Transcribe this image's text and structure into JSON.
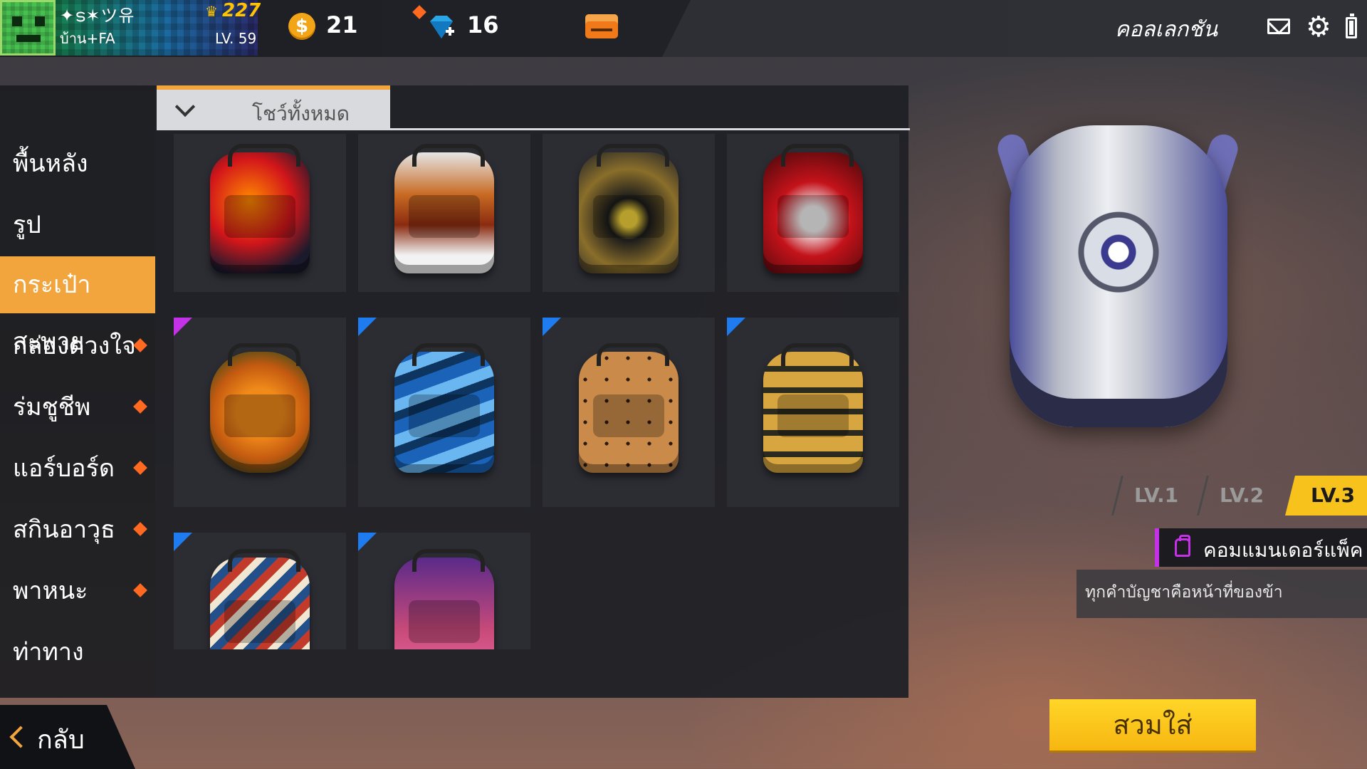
{
  "player": {
    "name": "✦ട✶ツ유",
    "subtitle": "บ้าน+FA",
    "score": "227",
    "level": "LV. 59"
  },
  "currency": {
    "coins_symbol": "$",
    "coins": "21",
    "diamonds": "16"
  },
  "header": {
    "title": "คอลเลกชัน"
  },
  "icons": {
    "gear": "⚙",
    "crown": "♛"
  },
  "sidebar": {
    "items": [
      {
        "label": "พื้นหลัง"
      },
      {
        "label": "รูป"
      },
      {
        "label": "กระเป๋าสะพาย"
      },
      {
        "label": "กล่องดวงใจ"
      },
      {
        "label": "ร่มชูชีพ"
      },
      {
        "label": "แอร์บอร์ด"
      },
      {
        "label": "สกินอาวุธ"
      },
      {
        "label": "พาหนะ"
      },
      {
        "label": "ท่าทาง"
      }
    ],
    "active_index": 2
  },
  "filter": {
    "label": "โชว์ทั้งหมด"
  },
  "item_grid": {
    "items": [
      {
        "name": "flame-backpack",
        "rarity": "none"
      },
      {
        "name": "tiger-backpack",
        "rarity": "none"
      },
      {
        "name": "gold-emblem-backpack",
        "rarity": "none"
      },
      {
        "name": "red-mask-backpack",
        "rarity": "none"
      },
      {
        "name": "pumpkin-backpack",
        "rarity": "epic"
      },
      {
        "name": "blue-camo-backpack",
        "rarity": "rare"
      },
      {
        "name": "leopard-backpack",
        "rarity": "rare"
      },
      {
        "name": "gold-stripe-backpack",
        "rarity": "rare"
      },
      {
        "name": "patchwork-backpack",
        "rarity": "rare"
      },
      {
        "name": "purple-backpack",
        "rarity": "rare"
      }
    ]
  },
  "preview": {
    "levels": [
      "LV.1",
      "LV.2",
      "LV.3"
    ],
    "selected_level": "LV.3",
    "item_name": "คอมแมนเดอร์แพ็ค",
    "description": "ทุกคำบัญชาคือหน้าที่ของข้า"
  },
  "actions": {
    "equip": "สวมใส่",
    "back": "กลับ"
  },
  "colors": {
    "accent": "#f2a43d",
    "equip": "#f8c21d",
    "rare": "#1e7cf0",
    "epic": "#c431e6"
  }
}
